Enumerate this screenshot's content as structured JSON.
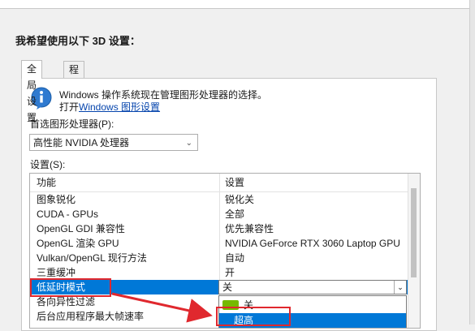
{
  "heading": "我希望使用以下 3D 设置：",
  "tabs": [
    "全局设置",
    "程序设置"
  ],
  "info": {
    "line1": "Windows 操作系统现在管理图形处理器的选择。",
    "line2_prefix": "打开",
    "line2_link": "Windows 图形设置"
  },
  "preferred_gpu": {
    "label": "首选图形处理器(P):",
    "value": "高性能 NVIDIA 处理器"
  },
  "settings_label": "设置(S):",
  "grid": {
    "headers": [
      "功能",
      "设置"
    ],
    "rows": [
      [
        "图象锐化",
        "锐化关"
      ],
      [
        "CUDA - GPUs",
        "全部"
      ],
      [
        "OpenGL GDI 兼容性",
        "优先兼容性"
      ],
      [
        "OpenGL 渲染 GPU",
        "NVIDIA GeForce RTX 3060 Laptop GPU"
      ],
      [
        "Vulkan/OpenGL 现行方法",
        "自动"
      ],
      [
        "三重缓冲",
        "开"
      ],
      [
        "低延时模式",
        "关"
      ],
      [
        "各向异性过滤",
        ""
      ],
      [
        "后台应用程序最大帧速率",
        ""
      ]
    ],
    "dropdown_options": [
      "关",
      "超高"
    ]
  },
  "colors": {
    "selection": "#0078d7",
    "highlight_box": "#e0282e",
    "nvidia": "#76b900"
  }
}
